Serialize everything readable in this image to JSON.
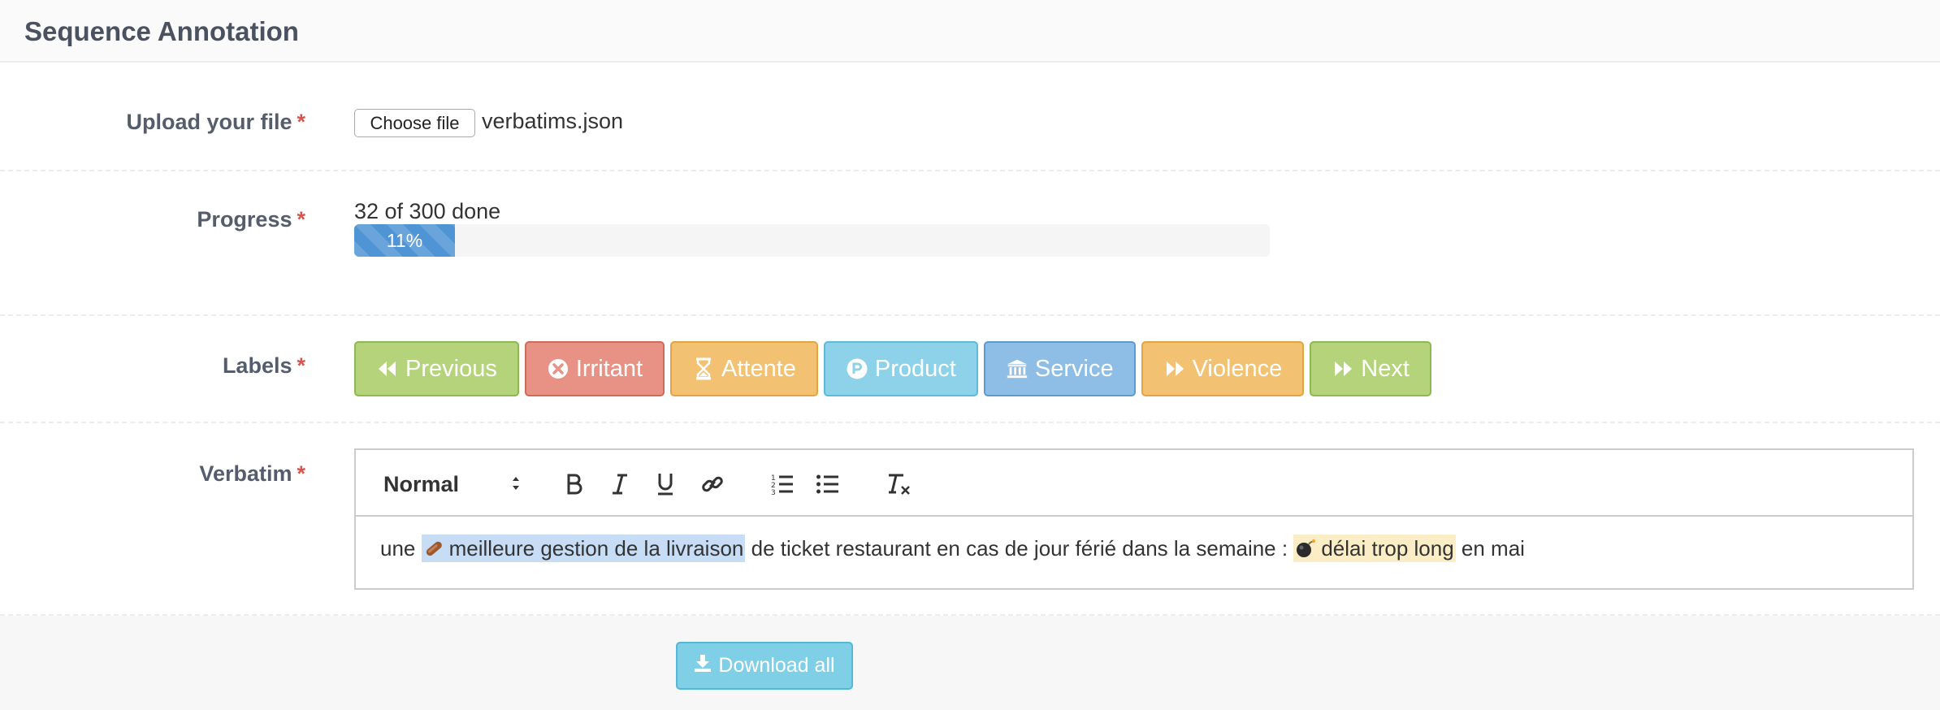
{
  "header": {
    "title": "Sequence Annotation"
  },
  "upload": {
    "label": "Upload your file",
    "required_mark": "*",
    "choose_button": "Choose file",
    "file_name": "verbatims.json"
  },
  "progress": {
    "label": "Progress",
    "required_mark": "*",
    "text": "32 of 300 done",
    "percent_label": "11%",
    "fraction": 0.11
  },
  "labels": {
    "label": "Labels",
    "required_mark": "*",
    "buttons": [
      {
        "text": "Previous",
        "icon": "backward-icon",
        "color": "#b5d37a"
      },
      {
        "text": "Irritant",
        "icon": "circle-x-icon",
        "color": "#e79285"
      },
      {
        "text": "Attente",
        "icon": "hourglass-icon",
        "color": "#f2c172"
      },
      {
        "text": "Product",
        "icon": "circle-p-icon",
        "color": "#8dd2e8"
      },
      {
        "text": "Service",
        "icon": "bank-icon",
        "color": "#8ebde5"
      },
      {
        "text": "Violence",
        "icon": "forward-icon",
        "color": "#f2c172"
      },
      {
        "text": "Next",
        "icon": "forward-icon",
        "color": "#b5d37a"
      }
    ]
  },
  "verbatim": {
    "label": "Verbatim",
    "required_mark": "*",
    "toolbar": {
      "format_value": "Normal",
      "tools": [
        "bold-icon",
        "italic-icon",
        "underline-icon",
        "link-icon",
        "ordered-list-icon",
        "bullet-list-icon",
        "clear-format-icon"
      ]
    },
    "content": {
      "part1": "une",
      "highlight1": "meilleure gestion de la livraison",
      "highlight1_icon": "sausage-icon",
      "part2": "de ticket restaurant en cas de jour férié dans la semaine :",
      "highlight2": "délai trop long",
      "highlight2_icon": "bomb-icon",
      "part3": "en mai"
    }
  },
  "footer": {
    "download_button": "Download all",
    "download_icon": "download-icon"
  }
}
